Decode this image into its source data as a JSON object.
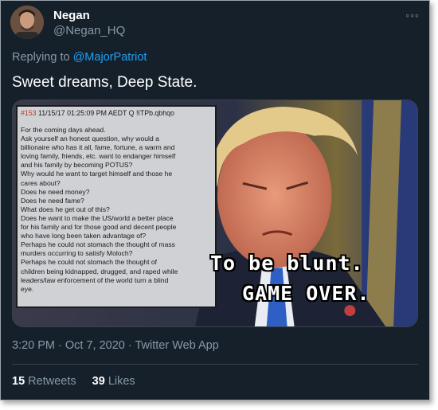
{
  "author": {
    "display_name": "Negan",
    "handle": "@Negan_HQ",
    "avatar_icon": "user-avatar-photo"
  },
  "more_label": "◦◦◦",
  "reply": {
    "prefix": "Replying to ",
    "target": "@MajorPatriot"
  },
  "tweet_text": "Sweet dreams, Deep State.",
  "media": {
    "post_header": {
      "number": "#153",
      "info": "11/15/17 01:25:09 PM AEDT Q !ITPb.qbhqo"
    },
    "post_lines": [
      "For the coming days ahead.",
      "Ask yourself an honest question, why would a",
      "billionaire who has it all, fame, fortune, a warm and",
      "loving family, friends, etc. want to endanger himself",
      "and his family by becoming POTUS?",
      "Why would he want to target himself and those he",
      "cares about?",
      "Does he need money?",
      "Does he need fame?",
      "What does he get out of this?",
      "Does he want to make the US/world a better place",
      "for his family and for those good and decent people",
      "who have long been taken advantage of?",
      "Perhaps he could not stomach the thought of mass",
      "murders occurring to satisfy Moloch?",
      "Perhaps he could not stomach the thought of",
      "children being kidnapped, drugged, and raped while",
      "leaders/law enforcement of the world turn a blind",
      "eye."
    ],
    "caption_line1": "To be blunt.",
    "caption_line2": "GAME OVER."
  },
  "meta": {
    "time": "3:20 PM",
    "separator": " · ",
    "date": "Oct 7, 2020",
    "source": "Twitter Web App"
  },
  "stats": {
    "retweets_count": "15",
    "retweets_label": "Retweets",
    "likes_count": "39",
    "likes_label": "Likes"
  },
  "colors": {
    "background": "#15202b",
    "link": "#1da1f2",
    "secondary_text": "#8899a6"
  }
}
